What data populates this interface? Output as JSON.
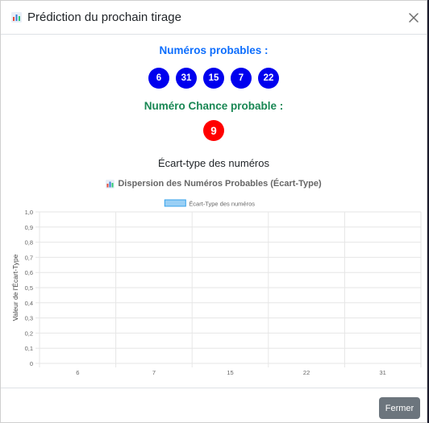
{
  "modal": {
    "title": "Prédiction du prochain tirage",
    "close_icon": "close-icon",
    "header_icon": "bar-chart-icon"
  },
  "numbers_section": {
    "title": "Numéros probables :",
    "title_color": "#0d6efd",
    "ball_color": "#0000ee",
    "numbers": [
      "6",
      "31",
      "15",
      "7",
      "22"
    ]
  },
  "chance_section": {
    "title": "Numéro Chance probable :",
    "title_color": "#198754",
    "ball_color": "#ff0000",
    "number": "9"
  },
  "std_section": {
    "title": "Écart-type des numéros"
  },
  "chart": {
    "title": "Dispersion des Numéros Probables (Écart-Type)",
    "title_icon": "bar-chart-icon"
  },
  "chart_data": {
    "type": "bar",
    "title": "Dispersion des Numéros Probables (Écart-Type)",
    "categories": [
      "6",
      "7",
      "15",
      "22",
      "31"
    ],
    "series": [
      {
        "name": "Écart-Type des numéros",
        "values": [
          0,
          0,
          0,
          0,
          0
        ],
        "color": "#9ad0f5",
        "border_color": "#36a2eb"
      }
    ],
    "ylabel": "Valeur de l'Écart-Type",
    "xlabel": "",
    "ylim": [
      0,
      1
    ],
    "y_ticks": [
      "1,0",
      "0,9",
      "0,8",
      "0,7",
      "0,6",
      "0,5",
      "0,4",
      "0,3",
      "0,2",
      "0,1",
      "0"
    ],
    "legend": "top",
    "grid": true
  },
  "footer": {
    "close_label": "Fermer",
    "close_color": "#6c757d"
  }
}
